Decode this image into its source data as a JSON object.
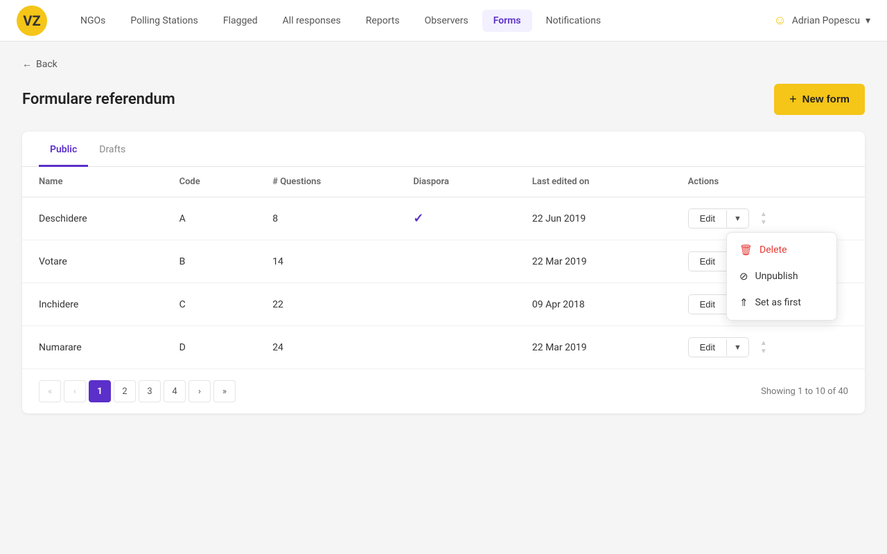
{
  "nav": {
    "logo": "VZ",
    "items": [
      {
        "label": "NGOs",
        "active": false
      },
      {
        "label": "Polling Stations",
        "active": false
      },
      {
        "label": "Flagged",
        "active": false
      },
      {
        "label": "All responses",
        "active": false
      },
      {
        "label": "Reports",
        "active": false
      },
      {
        "label": "Observers",
        "active": false
      },
      {
        "label": "Forms",
        "active": true
      },
      {
        "label": "Notifications",
        "active": false
      }
    ],
    "user": "Adrian Popescu",
    "user_caret": "▾"
  },
  "back_label": "Back",
  "page_title": "Formulare referendum",
  "new_form_button": "New form",
  "tabs": [
    {
      "label": "Public",
      "active": true
    },
    {
      "label": "Drafts",
      "active": false
    }
  ],
  "table": {
    "columns": [
      "Name",
      "Code",
      "# Questions",
      "Diaspora",
      "Last edited on",
      "Actions"
    ],
    "rows": [
      {
        "name": "Deschidere",
        "code": "A",
        "questions": "8",
        "diaspora": true,
        "last_edited": "22 Jun 2019",
        "show_dropdown": true
      },
      {
        "name": "Votare",
        "code": "B",
        "questions": "14",
        "diaspora": false,
        "last_edited": "22 Mar 2019",
        "show_dropdown": false
      },
      {
        "name": "Inchidere",
        "code": "C",
        "questions": "22",
        "diaspora": false,
        "last_edited": "09 Apr 2018",
        "show_dropdown": false
      },
      {
        "name": "Numarare",
        "code": "D",
        "questions": "24",
        "diaspora": false,
        "last_edited": "22 Mar 2019",
        "show_dropdown": false
      }
    ]
  },
  "dropdown_menu": {
    "delete_label": "Delete",
    "unpublish_label": "Unpublish",
    "set_as_first_label": "Set as first"
  },
  "pagination": {
    "pages": [
      "1",
      "2",
      "3",
      "4"
    ],
    "showing": "Showing 1 to 10 of 40"
  }
}
